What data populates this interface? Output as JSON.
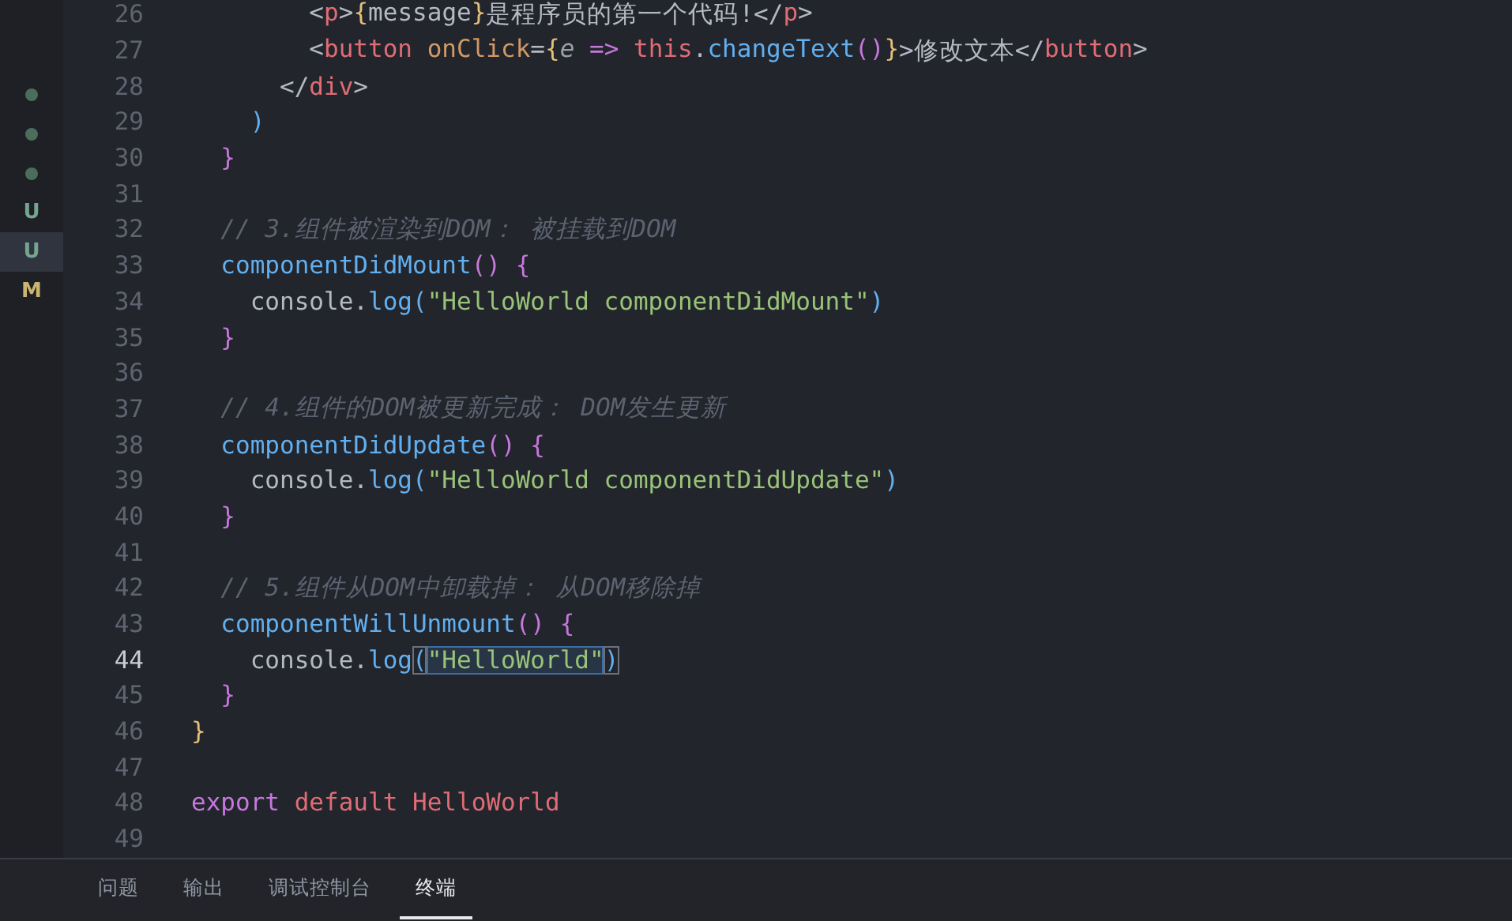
{
  "scm_markers": [
    {
      "kind": "dot",
      "color": "#4a6e5b",
      "selected": false
    },
    {
      "kind": "dot",
      "color": "#4a6e5b",
      "selected": false
    },
    {
      "kind": "dot",
      "color": "#4a6e5b",
      "selected": false
    },
    {
      "kind": "letter",
      "text": "U",
      "color": "#73a58f",
      "selected": false
    },
    {
      "kind": "letter",
      "text": "U",
      "color": "#73a58f",
      "selected": true
    },
    {
      "kind": "letter",
      "text": "M",
      "color": "#c9b66f",
      "selected": false
    }
  ],
  "lines": [
    {
      "number": "26",
      "current": false,
      "tokens": [
        {
          "kind": "plain",
          "text": "        <"
        },
        {
          "kind": "tag",
          "text": "p"
        },
        {
          "kind": "plain",
          "text": ">"
        },
        {
          "kind": "brace-y",
          "text": "{"
        },
        {
          "kind": "plain",
          "text": "message"
        },
        {
          "kind": "brace-y",
          "text": "}"
        },
        {
          "kind": "plain",
          "text": "是程序员的第一个代码!</"
        },
        {
          "kind": "tag",
          "text": "p"
        },
        {
          "kind": "plain",
          "text": ">"
        }
      ]
    },
    {
      "number": "27",
      "current": false,
      "tokens": [
        {
          "kind": "plain",
          "text": "        <"
        },
        {
          "kind": "tag",
          "text": "button"
        },
        {
          "kind": "attr",
          "text": " onClick"
        },
        {
          "kind": "plain",
          "text": "="
        },
        {
          "kind": "brace-y",
          "text": "{"
        },
        {
          "kind": "param",
          "text": "e"
        },
        {
          "kind": "keyword",
          "text": " =>"
        },
        {
          "kind": "this",
          "text": " this"
        },
        {
          "kind": "plain",
          "text": "."
        },
        {
          "kind": "func",
          "text": "changeText"
        },
        {
          "kind": "paren-p",
          "text": "()"
        },
        {
          "kind": "brace-y",
          "text": "}"
        },
        {
          "kind": "plain",
          "text": ">修改文本</"
        },
        {
          "kind": "tag",
          "text": "button"
        },
        {
          "kind": "plain",
          "text": ">"
        }
      ]
    },
    {
      "number": "28",
      "current": false,
      "tokens": [
        {
          "kind": "plain",
          "text": "      </"
        },
        {
          "kind": "tag",
          "text": "div"
        },
        {
          "kind": "plain",
          "text": ">"
        }
      ]
    },
    {
      "number": "29",
      "current": false,
      "tokens": [
        {
          "kind": "paren-b",
          "text": "    )"
        }
      ]
    },
    {
      "number": "30",
      "current": false,
      "tokens": [
        {
          "kind": "brace-p",
          "text": "  }"
        }
      ]
    },
    {
      "number": "31",
      "current": false
    },
    {
      "number": "32",
      "current": false,
      "tokens": [
        {
          "kind": "comment",
          "text": "  // 3.组件被渲染到DOM： 被挂载到DOM"
        }
      ]
    },
    {
      "number": "33",
      "current": false,
      "tokens": [
        {
          "kind": "func",
          "text": "  componentDidMount"
        },
        {
          "kind": "paren-p",
          "text": "()"
        },
        {
          "kind": "brace-p",
          "text": " {"
        }
      ]
    },
    {
      "number": "34",
      "current": false,
      "tokens": [
        {
          "kind": "plain",
          "text": "    console."
        },
        {
          "kind": "func",
          "text": "log"
        },
        {
          "kind": "paren-b",
          "text": "("
        },
        {
          "kind": "string",
          "text": "\"HelloWorld componentDidMount\""
        },
        {
          "kind": "paren-b",
          "text": ")"
        }
      ]
    },
    {
      "number": "35",
      "current": false,
      "tokens": [
        {
          "kind": "brace-p",
          "text": "  }"
        }
      ]
    },
    {
      "number": "36",
      "current": false
    },
    {
      "number": "37",
      "current": false,
      "tokens": [
        {
          "kind": "comment",
          "text": "  // 4.组件的DOM被更新完成： DOM发生更新"
        }
      ]
    },
    {
      "number": "38",
      "current": false,
      "tokens": [
        {
          "kind": "func",
          "text": "  componentDidUpdate"
        },
        {
          "kind": "paren-p",
          "text": "()"
        },
        {
          "kind": "brace-p",
          "text": " {"
        }
      ]
    },
    {
      "number": "39",
      "current": false,
      "tokens": [
        {
          "kind": "plain",
          "text": "    console."
        },
        {
          "kind": "func",
          "text": "log"
        },
        {
          "kind": "paren-b",
          "text": "("
        },
        {
          "kind": "string",
          "text": "\"HelloWorld componentDidUpdate\""
        },
        {
          "kind": "paren-b",
          "text": ")"
        }
      ]
    },
    {
      "number": "40",
      "current": false,
      "tokens": [
        {
          "kind": "brace-p",
          "text": "  }"
        }
      ]
    },
    {
      "number": "41",
      "current": false
    },
    {
      "number": "42",
      "current": false,
      "tokens": [
        {
          "kind": "comment",
          "text": "  // 5.组件从DOM中卸载掉： 从DOM移除掉"
        }
      ]
    },
    {
      "number": "43",
      "current": false,
      "tokens": [
        {
          "kind": "func",
          "text": "  componentWillUnmount"
        },
        {
          "kind": "paren-p",
          "text": "()"
        },
        {
          "kind": "brace-p",
          "text": " {"
        }
      ]
    },
    {
      "number": "44",
      "current": true,
      "tokens": [
        {
          "kind": "plain",
          "text": "    console."
        },
        {
          "kind": "func",
          "text": "log"
        },
        {
          "kind": "paren-match",
          "text": "("
        },
        {
          "kind": "string-selected",
          "text": "\"HelloWorld\""
        },
        {
          "kind": "paren-match",
          "text": ")"
        }
      ]
    },
    {
      "number": "45",
      "current": false,
      "tokens": [
        {
          "kind": "brace-p",
          "text": "  }"
        }
      ]
    },
    {
      "number": "46",
      "current": false,
      "tokens": [
        {
          "kind": "brace-y",
          "text": "}"
        }
      ]
    },
    {
      "number": "47",
      "current": false
    },
    {
      "number": "48",
      "current": false,
      "tokens": [
        {
          "kind": "keyword",
          "text": "export"
        },
        {
          "kind": "this",
          "text": " default"
        },
        {
          "kind": "this",
          "text": " HelloWorld"
        }
      ]
    },
    {
      "number": "49",
      "current": false
    }
  ],
  "panel_tabs": [
    {
      "label": "问题",
      "selected": false
    },
    {
      "label": "输出",
      "selected": false
    },
    {
      "label": "调试控制台",
      "selected": false
    },
    {
      "label": "终端",
      "selected": true
    }
  ]
}
